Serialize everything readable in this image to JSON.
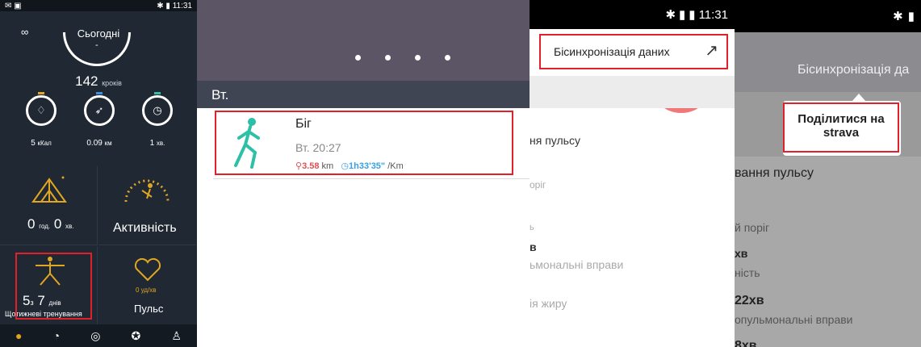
{
  "p1": {
    "status_time": "11:31",
    "title": "Сьогодні",
    "dash": "-",
    "steps_value": "142",
    "steps_unit": "кроків",
    "kcal": "5",
    "kcal_unit": "кКал",
    "km": "0.09",
    "km_unit": "км",
    "min": "1",
    "min_unit": "хв.",
    "sleep_h": "0",
    "sleep_h_unit": "год.",
    "sleep_m": "0",
    "sleep_m_unit": "хв.",
    "activity": "Активність",
    "training_a": "5",
    "training_of": "з",
    "training_b": "7",
    "training_unit": "днів",
    "training_label": "Щотижневі тренування",
    "pulse_value": "0 уд/хв",
    "pulse": "Пульс"
  },
  "p2": {
    "day": "Вт.",
    "activity": "Біг",
    "date": "Вт.  20:27",
    "distance": "3.58",
    "distance_unit": "km",
    "pace": "1h33'35\"",
    "pace_unit": "/Km"
  },
  "p3": {
    "status_time": "11:31",
    "sync": "Біcинхронізація даних",
    "l1": "ня пульсу",
    "l2": "оріг",
    "l3": "ь",
    "l4": "в",
    "l5": "ьмональні вправи",
    "l6": "ія жиру"
  },
  "p4": {
    "sync": "Біcинхронізація да",
    "share_line1": "Поділитися на",
    "share_line2": "strava",
    "l1": "вання пульсу",
    "l2": "й поріг",
    "l3": "хв",
    "l4": "ність",
    "l5": "22хв",
    "l6": "опульмональні вправи",
    "l7": "8хв"
  },
  "colors": {
    "accent_red": "#e0212a",
    "gold": "#e0a622",
    "runner": "#2cc0a8"
  }
}
